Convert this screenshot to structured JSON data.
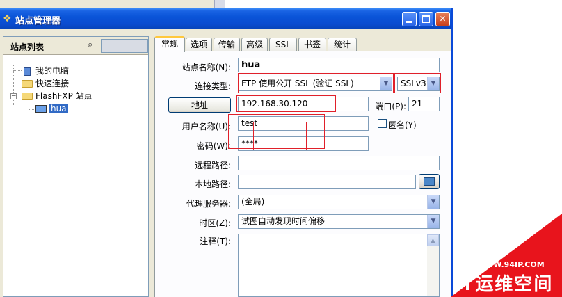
{
  "window": {
    "title": "站点管理器",
    "minimize": "_",
    "close": "✕"
  },
  "left": {
    "header": "站点列表",
    "tree": [
      {
        "label": "我的电脑",
        "icon": "computer-icon"
      },
      {
        "label": "快速连接",
        "icon": "folder-icon"
      },
      {
        "label": "FlashFXP 站点",
        "icon": "folder-icon"
      },
      {
        "label": "hua",
        "icon": "monitor-icon",
        "selected": true
      }
    ],
    "expander": "−"
  },
  "tabs": [
    "常规",
    "选项",
    "传输",
    "高级",
    "SSL",
    "书签",
    "统计"
  ],
  "form": {
    "site_name_label": "站点名称(N):",
    "site_name_value": "hua",
    "conn_type_label": "连接类型:",
    "conn_type_value": "FTP 使用公开 SSL (验证 SSL)",
    "ssl_version_value": "SSLv3",
    "address_button": "地址",
    "address_value": "192.168.30.120",
    "port_label": "端口(P):",
    "port_value": "21",
    "user_label": "用户名称(U):",
    "user_value": "test",
    "anon_label": "匿名(Y)",
    "password_label": "密码(W):",
    "password_value": "****",
    "remote_path_label": "远程路径:",
    "remote_path_value": "",
    "local_path_label": "本地路径:",
    "local_path_value": "",
    "proxy_label": "代理服务器:",
    "proxy_value": "(全局)",
    "timezone_label": "时区(Z):",
    "timezone_value": "试图自动发现时间偏移",
    "notes_label": "注释(T):"
  },
  "watermark": {
    "url": "WWW.94IP.COM",
    "text": "IT运维空间"
  },
  "colors": {
    "titlebar": "#0a54d8",
    "annotation": "#e0202a",
    "watermark": "#e8141c",
    "selection": "#316ac5"
  }
}
